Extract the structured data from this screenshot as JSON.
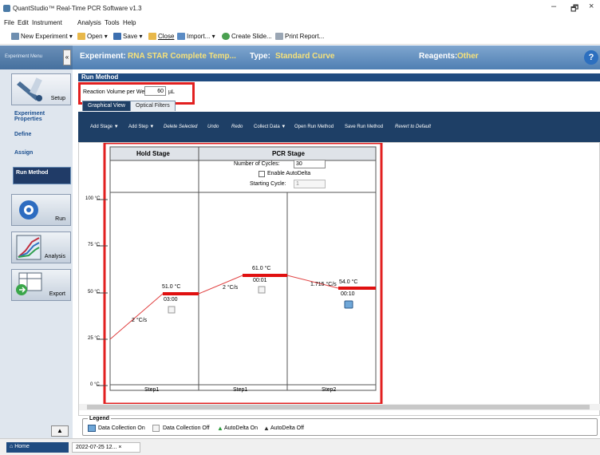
{
  "titlebar": {
    "title": "QuantStudio™ Real-Time PCR Software v1.3",
    "min": "–",
    "restore": "🗗",
    "close": "×"
  },
  "menu": [
    "File",
    "Edit",
    "Instrument",
    "Analysis",
    "Tools",
    "Help"
  ],
  "toolbar": {
    "new": "New Experiment ▾",
    "open": "Open ▾",
    "save": "Save ▾",
    "close": "Close",
    "import": "Import... ▾",
    "slide": "Create Slide...",
    "print": "Print Report..."
  },
  "sidebar": {
    "header": "Experiment Menu",
    "collapse": "«",
    "setup": "Setup",
    "exp_props": "Experiment Properties",
    "define": "Define",
    "assign": "Assign",
    "run_method": "Run Method",
    "run": "Run",
    "analysis": "Analysis",
    "export": "Export",
    "up": "▲"
  },
  "experiment": {
    "label": "Experiment:",
    "name": "RNA STAR Complete Temp...",
    "type_label": "Type:",
    "type": "Standard Curve",
    "reagents_label": "Reagents:",
    "reagents": "Other",
    "help": "?"
  },
  "run_method": {
    "title": "Run Method",
    "reaction_volume_label": "Reaction Volume per Well:",
    "reaction_volume": "60",
    "unit": "µL"
  },
  "tabs": [
    "Graphical View",
    "Optical Filters"
  ],
  "subtoolbar": [
    "Add Stage ▼",
    "Add Step ▼",
    "Delete Selected",
    "Undo",
    "Redo",
    "Collect Data ▼",
    "Open Run Method",
    "Save Run Method",
    "Revert to Default"
  ],
  "graph": {
    "y_ticks": [
      "100 °C",
      "75 °C",
      "50 °C",
      "25 °C",
      "0 °C"
    ],
    "hold_stage": {
      "title": "Hold Stage",
      "step": "Step1",
      "temp": "51.0 °C",
      "time": "03:00",
      "ramp": "2 °C/s"
    },
    "pcr_stage": {
      "title": "PCR Stage",
      "cycles_label": "Number of Cycles:",
      "cycles": "30",
      "autodelta": "Enable AutoDelta",
      "start_label": "Starting Cycle:",
      "start": "1",
      "step1": {
        "name": "Step1",
        "temp": "61.0 °C",
        "time": "00:01",
        "ramp": "2 °C/s"
      },
      "step2": {
        "name": "Step2",
        "temp": "54.0 °C",
        "time": "00:10",
        "ramp": "1.715 °C/s"
      }
    }
  },
  "legend": {
    "title": "Legend",
    "on": "Data Collection On",
    "off": "Data Collection Off",
    "ad_on": "AutoDelta On",
    "ad_off": "AutoDelta Off"
  },
  "taskbar": {
    "home": "Home",
    "doc": "2022-07-25 12..."
  }
}
